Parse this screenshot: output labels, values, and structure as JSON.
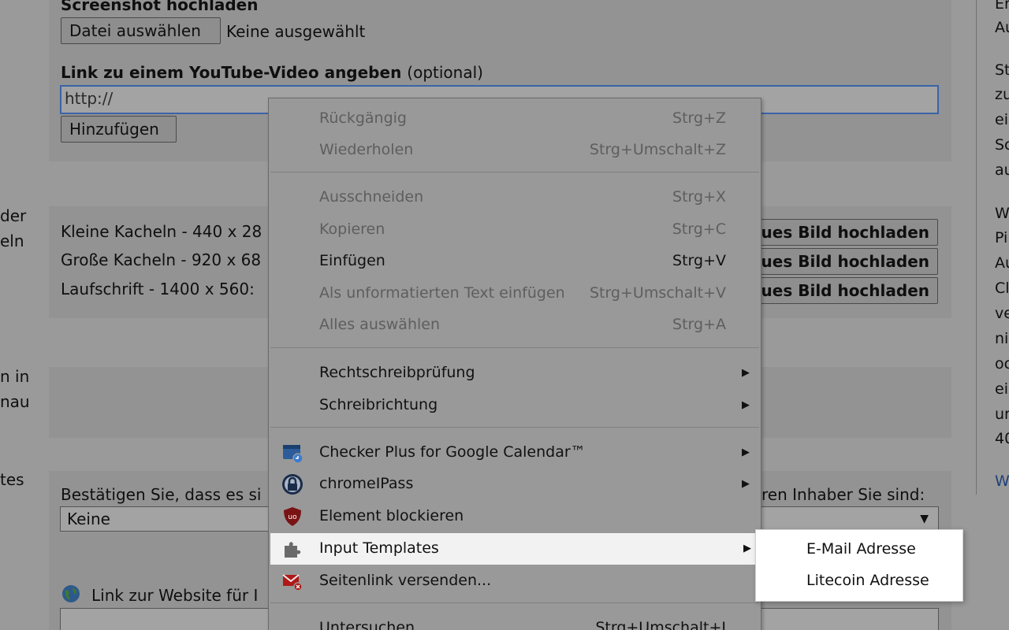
{
  "screenshot_section": {
    "title": "Screenshot hochladen",
    "file_button": "Datei auswählen",
    "file_status": "Keine ausgewählt"
  },
  "youtube": {
    "label": "Link zu einem YouTube-Video angeben",
    "label_optional": "(optional)",
    "input_value": "http://",
    "add_button": "Hinzufügen"
  },
  "left_fragments": [
    "der",
    "eln",
    "n in",
    "nau",
    "tes"
  ],
  "tiles": {
    "rows": [
      {
        "label": "Kleine Kacheln - 440 x 28",
        "button": "eues Bild hochladen"
      },
      {
        "label": "Große Kacheln - 920 x 68",
        "button": "eues Bild hochladen"
      },
      {
        "label": "Laufschrift - 1400 x 560:",
        "button": "eues Bild hochladen"
      }
    ]
  },
  "confirm": {
    "label_left": "Bestätigen Sie, dass es si",
    "label_right": "ren Inhaber Sie sind:",
    "select_value": "Keine"
  },
  "website": {
    "label": "Link zur Website für I"
  },
  "sidebar": {
    "lines": [
      "Er",
      "Au",
      "St",
      "zu",
      "ei",
      "Sc",
      "au",
      "W",
      "Pi",
      "Au",
      "Cl",
      "ve",
      "ni",
      "oc",
      "ei",
      "ur",
      "40",
      "W"
    ]
  },
  "context_menu": {
    "undo": {
      "label": "Rückgängig",
      "shortcut": "Strg+Z"
    },
    "redo": {
      "label": "Wiederholen",
      "shortcut": "Strg+Umschalt+Z"
    },
    "cut": {
      "label": "Ausschneiden",
      "shortcut": "Strg+X"
    },
    "copy": {
      "label": "Kopieren",
      "shortcut": "Strg+C"
    },
    "paste": {
      "label": "Einfügen",
      "shortcut": "Strg+V"
    },
    "paste_plain": {
      "label": "Als unformatierten Text einfügen",
      "shortcut": "Strg+Umschalt+V"
    },
    "select_all": {
      "label": "Alles auswählen",
      "shortcut": "Strg+A"
    },
    "spellcheck": {
      "label": "Rechtschreibprüfung"
    },
    "writing_direction": {
      "label": "Schreibrichtung"
    },
    "checker_plus": {
      "label": "Checker Plus for Google Calendar™"
    },
    "chromeipass": {
      "label": "chromeIPass"
    },
    "block_element": {
      "label": "Element blockieren"
    },
    "input_templates": {
      "label": "Input Templates"
    },
    "send_link": {
      "label": "Seitenlink versenden..."
    },
    "inspect": {
      "label": "Untersuchen",
      "shortcut": "Strg+Umschalt+I"
    },
    "submenu_arrow": "▶"
  },
  "input_templates_submenu": {
    "items": [
      "E-Mail Adresse",
      "Litecoin Adresse"
    ]
  },
  "colors": {
    "accent": "#3a63a8",
    "highlight": "#f2f2f2",
    "ublock_red": "#8b1a1a"
  }
}
